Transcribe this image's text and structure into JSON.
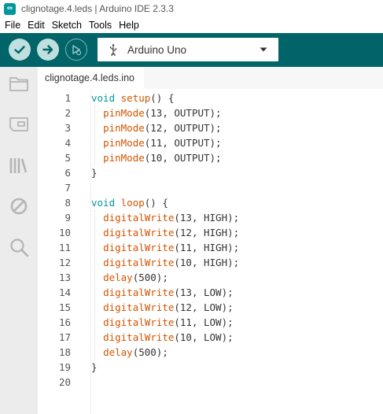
{
  "window": {
    "title": "clignotage.4.leds | Arduino IDE 2.3.3"
  },
  "menu": [
    "File",
    "Edit",
    "Sketch",
    "Tools",
    "Help"
  ],
  "toolbar": {
    "board": "Arduino Uno",
    "icons": [
      "verify-icon",
      "upload-icon",
      "debug-icon"
    ],
    "color": "#006468"
  },
  "sidebar": {
    "icons": [
      "sketchbook-folder-icon",
      "boards-manager-icon",
      "library-manager-icon",
      "debug-icon",
      "search-icon"
    ]
  },
  "editor": {
    "tab": "clignotage.4.leds.ino",
    "lines": [
      [
        [
          "kw",
          "void "
        ],
        [
          "fn",
          "setup"
        ],
        [
          "p",
          "() {"
        ]
      ],
      [
        [
          "p",
          "  "
        ],
        [
          "fn",
          "pinMode"
        ],
        [
          "p",
          "(13, OUTPUT);"
        ]
      ],
      [
        [
          "p",
          "  "
        ],
        [
          "fn",
          "pinMode"
        ],
        [
          "p",
          "(12, OUTPUT);"
        ]
      ],
      [
        [
          "p",
          "  "
        ],
        [
          "fn",
          "pinMode"
        ],
        [
          "p",
          "(11, OUTPUT);"
        ]
      ],
      [
        [
          "p",
          "  "
        ],
        [
          "fn",
          "pinMode"
        ],
        [
          "p",
          "(10, OUTPUT);"
        ]
      ],
      [
        [
          "p",
          "}"
        ]
      ],
      [],
      [
        [
          "kw",
          "void "
        ],
        [
          "fn",
          "loop"
        ],
        [
          "p",
          "() {"
        ]
      ],
      [
        [
          "p",
          "  "
        ],
        [
          "fn",
          "digitalWrite"
        ],
        [
          "p",
          "(13, HIGH);"
        ]
      ],
      [
        [
          "p",
          "  "
        ],
        [
          "fn",
          "digitalWrite"
        ],
        [
          "p",
          "(12, HIGH);"
        ]
      ],
      [
        [
          "p",
          "  "
        ],
        [
          "fn",
          "digitalWrite"
        ],
        [
          "p",
          "(11, HIGH);"
        ]
      ],
      [
        [
          "p",
          "  "
        ],
        [
          "fn",
          "digitalWrite"
        ],
        [
          "p",
          "(10, HIGH);"
        ]
      ],
      [
        [
          "p",
          "  "
        ],
        [
          "fn",
          "delay"
        ],
        [
          "p",
          "(500);"
        ]
      ],
      [
        [
          "p",
          "  "
        ],
        [
          "fn",
          "digitalWrite"
        ],
        [
          "p",
          "(13, LOW);"
        ]
      ],
      [
        [
          "p",
          "  "
        ],
        [
          "fn",
          "digitalWrite"
        ],
        [
          "p",
          "(12, LOW);"
        ]
      ],
      [
        [
          "p",
          "  "
        ],
        [
          "fn",
          "digitalWrite"
        ],
        [
          "p",
          "(11, LOW);"
        ]
      ],
      [
        [
          "p",
          "  "
        ],
        [
          "fn",
          "digitalWrite"
        ],
        [
          "p",
          "(10, LOW);"
        ]
      ],
      [
        [
          "p",
          "  "
        ],
        [
          "fn",
          "delay"
        ],
        [
          "p",
          "(500);"
        ]
      ],
      [
        [
          "p",
          "}"
        ]
      ],
      []
    ]
  }
}
